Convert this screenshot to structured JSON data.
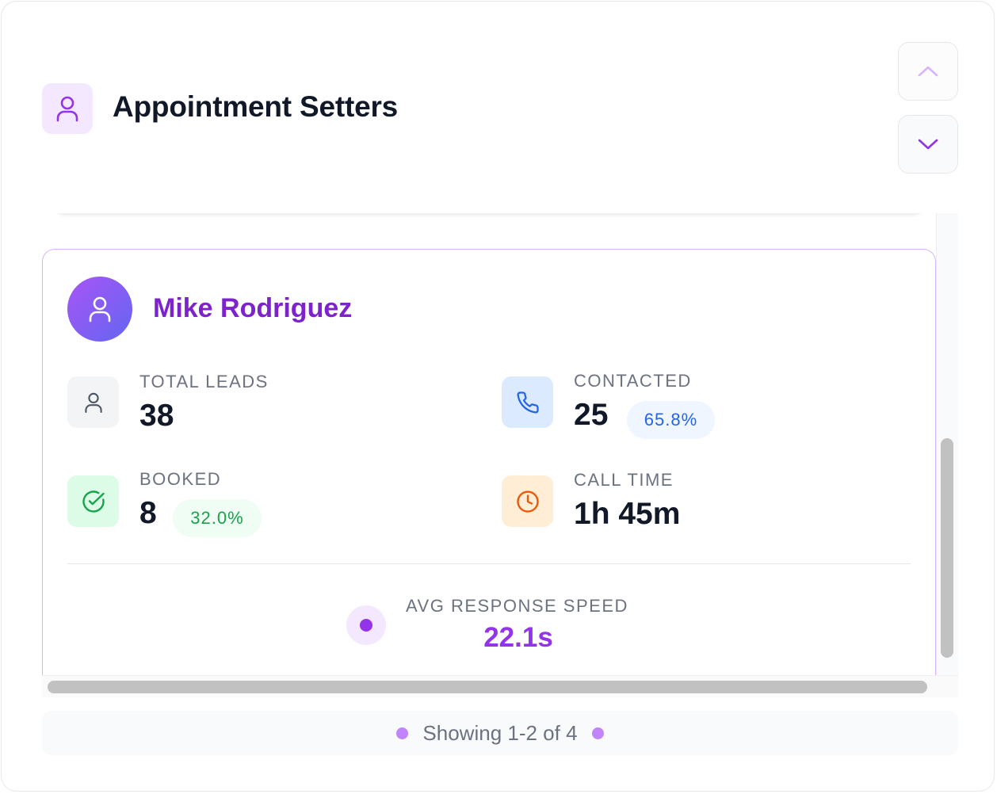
{
  "header": {
    "title": "Appointment Setters",
    "icon": "user-icon"
  },
  "nav": {
    "up_icon": "chevron-up-icon",
    "down_icon": "chevron-down-icon"
  },
  "setter": {
    "name": "Mike Rodriguez",
    "stats": {
      "total_leads": {
        "label": "TOTAL LEADS",
        "value": "38",
        "icon": "user-icon"
      },
      "contacted": {
        "label": "CONTACTED",
        "value": "25",
        "percent": "65.8%",
        "icon": "phone-icon"
      },
      "booked": {
        "label": "BOOKED",
        "value": "8",
        "percent": "32.0%",
        "icon": "check-circle-icon"
      },
      "call_time": {
        "label": "CALL TIME",
        "value": "1h 45m",
        "icon": "clock-icon"
      }
    },
    "avg_response": {
      "label": "AVG RESPONSE SPEED",
      "value": "22.1s"
    }
  },
  "footer": {
    "text": "Showing 1-2 of 4"
  },
  "colors": {
    "accent": "#9333ea",
    "name": "#7e22ce",
    "contacted_badge": "#2563eb",
    "booked_badge": "#16a34a",
    "call_time": "#ea580c"
  }
}
